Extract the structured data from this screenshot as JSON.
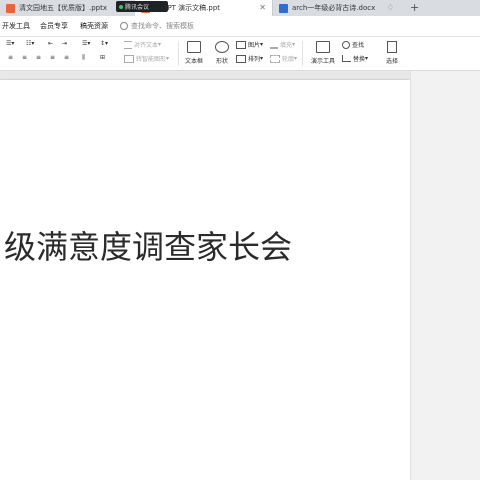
{
  "tabs": [
    {
      "label": "清文园地五【优质版】.pptx",
      "active": false,
      "icon_color": "#e8643a"
    },
    {
      "label": "稿 PPT 演示文稿.ppt",
      "active": true,
      "icon_color": "#e8643a"
    },
    {
      "label": "arch一年级必背古诗.docx",
      "active": false,
      "icon_color": "#2f6ccf"
    }
  ],
  "recording_label": "腾讯会议",
  "menu": {
    "items": [
      "开发工具",
      "会员专享",
      "稿壳资源"
    ],
    "search_placeholder": "查找命令、搜索模板"
  },
  "ribbon": {
    "align_text": "对齐文本",
    "smart_graphic": "转智能图形",
    "textbox": "文本框",
    "shape": "形状",
    "picture": "图片",
    "arrange": "排列",
    "fill": "填充",
    "outline": "轮廓",
    "presentation_tools": "演示工具",
    "find": "查找",
    "replace": "替换",
    "select": "选择"
  },
  "slide": {
    "title": "级满意度调查家长会"
  }
}
